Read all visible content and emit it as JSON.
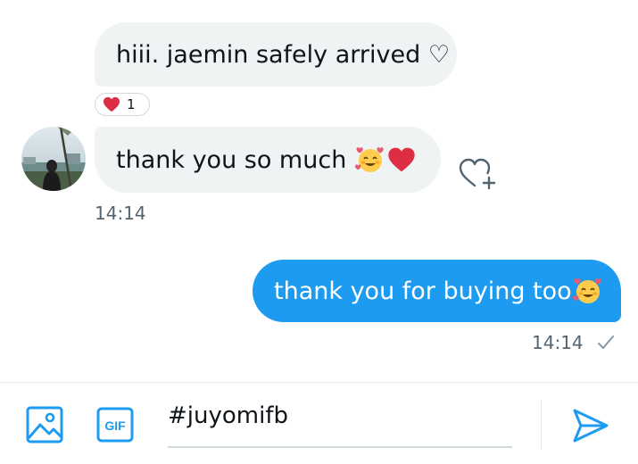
{
  "conversation": {
    "messages": [
      {
        "direction": "incoming",
        "text": "hiii. jaemin safely arrived ♡"
      },
      {
        "direction": "incoming",
        "text": "thank you so much",
        "emoji": [
          "hearts-face",
          "red-heart"
        ]
      },
      {
        "direction": "outgoing",
        "text": "thank you for buying too",
        "emoji": [
          "hearts-face"
        ]
      }
    ],
    "reaction": {
      "icon": "red-heart-icon",
      "count": "1"
    },
    "incoming_time": "14:14",
    "outgoing_time": "14:14",
    "outgoing_status": "sent-check-icon"
  },
  "composer": {
    "input_value": "#juyomifb",
    "gif_label": "GIF",
    "icons": [
      "image-icon",
      "gif-icon",
      "send-icon"
    ]
  },
  "colors": {
    "accent": "#1d9bf0",
    "incoming_bubble": "#eff3f4",
    "heart": "#e0245e",
    "muted_text": "#536471"
  }
}
